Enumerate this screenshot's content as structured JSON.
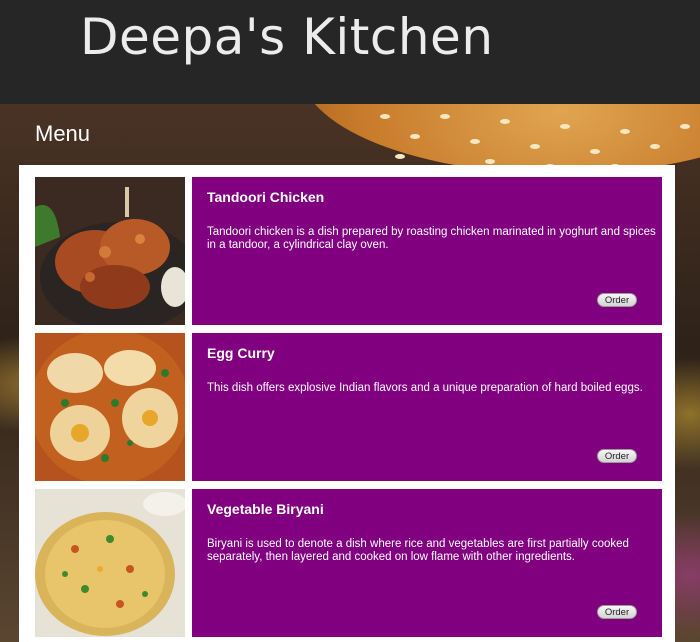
{
  "header": {
    "brand": "Deepa's Kitchen"
  },
  "menu": {
    "title": "Menu",
    "items": [
      {
        "name": "Tandoori Chicken",
        "description": "Tandoori chicken is a dish prepared by roasting chicken marinated in yoghurt and spices in a tandoor, a cylindrical clay oven.",
        "button": "Order"
      },
      {
        "name": "Egg Curry",
        "description": "This dish offers explosive Indian flavors and a unique preparation of hard boiled eggs.",
        "button": "Order"
      },
      {
        "name": "Vegetable Biryani",
        "description": "Biryani is used to denote a dish where rice and vegetables are first partially cooked separately, then layered and cooked on low flame with other ingredients.",
        "button": "Order"
      }
    ]
  },
  "colors": {
    "card": "#800080",
    "header": "#262626"
  }
}
